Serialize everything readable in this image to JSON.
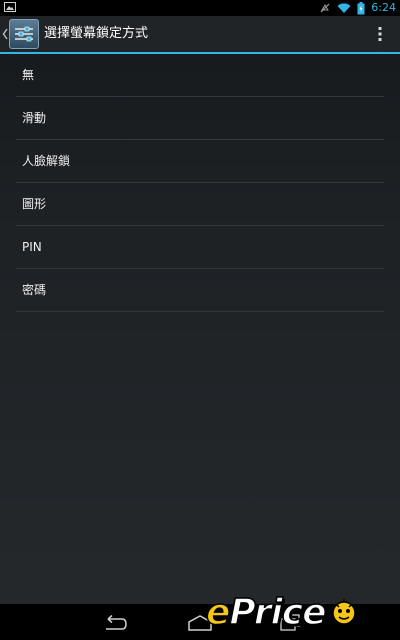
{
  "status_bar": {
    "time": "6:24",
    "icons": [
      "screenshot-icon",
      "notification-muted-icon",
      "wifi-icon",
      "battery-charging-icon"
    ],
    "accent_color": "#33b5e5"
  },
  "action_bar": {
    "title": "選擇螢幕鎖定方式",
    "icon": "settings-icon",
    "accent_color": "#33b5e5"
  },
  "lock_options": [
    {
      "label": "無"
    },
    {
      "label": "滑動"
    },
    {
      "label": "人臉解鎖"
    },
    {
      "label": "圖形"
    },
    {
      "label": "PIN"
    },
    {
      "label": "密碼"
    }
  ],
  "nav_bar": {
    "buttons": [
      "back-icon",
      "home-icon",
      "recent-apps-icon"
    ]
  },
  "watermark": {
    "text_e": "e",
    "text_rest": "Price"
  }
}
